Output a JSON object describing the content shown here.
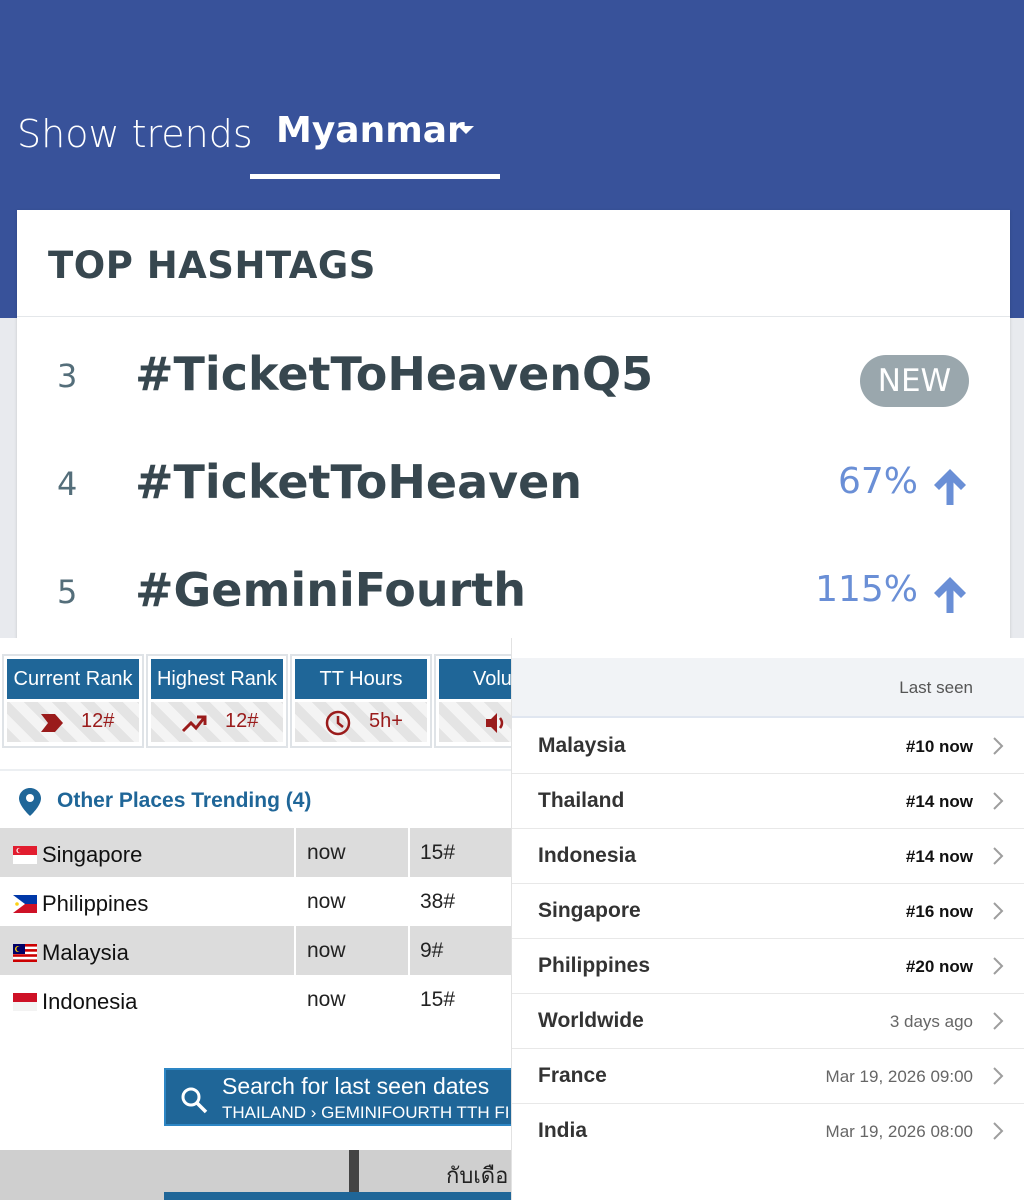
{
  "header": {
    "show_label": "Show trends",
    "country": "Myanmar",
    "bg_color": "#38529a"
  },
  "hashtags": {
    "title": "TOP HASHTAGS",
    "items": [
      {
        "rank": "3",
        "tag": "#TicketToHeavenQ5",
        "badge": "NEW"
      },
      {
        "rank": "4",
        "tag": "#TicketToHeaven",
        "change": "67%",
        "direction": "up"
      },
      {
        "rank": "5",
        "tag": "#GeminiFourth",
        "change": "115%",
        "direction": "up"
      }
    ]
  },
  "stats": {
    "boxes": [
      {
        "label": "Current Rank",
        "value": "12#",
        "icon": "rank-arrow-icon"
      },
      {
        "label": "Highest Rank",
        "value": "12#",
        "icon": "trending-up-icon"
      },
      {
        "label": "TT Hours",
        "value": "5h+",
        "icon": "clock-icon"
      },
      {
        "label": "Volu",
        "value": "",
        "icon": "volume-icon"
      }
    ]
  },
  "other_places": {
    "title": "Other Places Trending (4)",
    "rows": [
      {
        "country": "Singapore",
        "time": "now",
        "rank": "15#",
        "flag": "singapore-flag-icon"
      },
      {
        "country": "Philippines",
        "time": "now",
        "rank": "38#",
        "flag": "philippines-flag-icon"
      },
      {
        "country": "Malaysia",
        "time": "now",
        "rank": "9#",
        "flag": "malaysia-flag-icon"
      },
      {
        "country": "Indonesia",
        "time": "now",
        "rank": "15#",
        "flag": "indonesia-flag-icon"
      }
    ]
  },
  "search": {
    "title": "Search for last seen dates",
    "subtitle": "THAILAND › GEMINIFOURTH TTH FI"
  },
  "footer_text": "กับเดือ",
  "last_seen": {
    "header": "Last seen",
    "rows": [
      {
        "place": "Malaysia",
        "value": "#10 now",
        "current": true
      },
      {
        "place": "Thailand",
        "value": "#14 now",
        "current": true
      },
      {
        "place": "Indonesia",
        "value": "#14 now",
        "current": true
      },
      {
        "place": "Singapore",
        "value": "#16 now",
        "current": true
      },
      {
        "place": "Philippines",
        "value": "#20 now",
        "current": true
      },
      {
        "place": "Worldwide",
        "value": "3 days ago",
        "current": false
      },
      {
        "place": "France",
        "value": "Mar 19, 2026 09:00",
        "current": false
      },
      {
        "place": "India",
        "value": "Mar 19, 2026 08:00",
        "current": false
      }
    ]
  }
}
